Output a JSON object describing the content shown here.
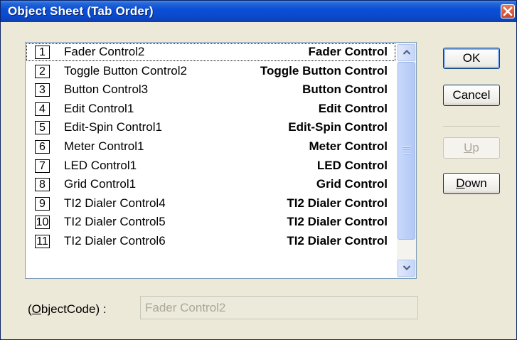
{
  "window": {
    "title": "Object Sheet (Tab Order)"
  },
  "list": {
    "items": [
      {
        "num": "1",
        "name": "Fader Control2",
        "type": "Fader Control"
      },
      {
        "num": "2",
        "name": "Toggle Button Control2",
        "type": "Toggle Button Control"
      },
      {
        "num": "3",
        "name": "Button Control3",
        "type": "Button Control"
      },
      {
        "num": "4",
        "name": "Edit Control1",
        "type": "Edit Control"
      },
      {
        "num": "5",
        "name": "Edit-Spin Control1",
        "type": "Edit-Spin Control"
      },
      {
        "num": "6",
        "name": "Meter Control1",
        "type": "Meter Control"
      },
      {
        "num": "7",
        "name": "LED Control1",
        "type": "LED Control"
      },
      {
        "num": "8",
        "name": "Grid Control1",
        "type": "Grid Control"
      },
      {
        "num": "9",
        "name": "TI2 Dialer Control4",
        "type": "TI2 Dialer Control"
      },
      {
        "num": "10",
        "name": "TI2 Dialer Control5",
        "type": "TI2 Dialer Control"
      },
      {
        "num": "11",
        "name": "TI2 Dialer Control6",
        "type": "TI2 Dialer Control"
      }
    ]
  },
  "buttons": {
    "ok": "OK",
    "cancel": "Cancel",
    "up_mnemonic": "U",
    "up_rest": "p",
    "down_mnemonic": "D",
    "down_rest": "own"
  },
  "object_code": {
    "label_open": "(",
    "label_mnemonic": "O",
    "label_rest": "bjectCode) :",
    "value": "Fader Control2"
  }
}
